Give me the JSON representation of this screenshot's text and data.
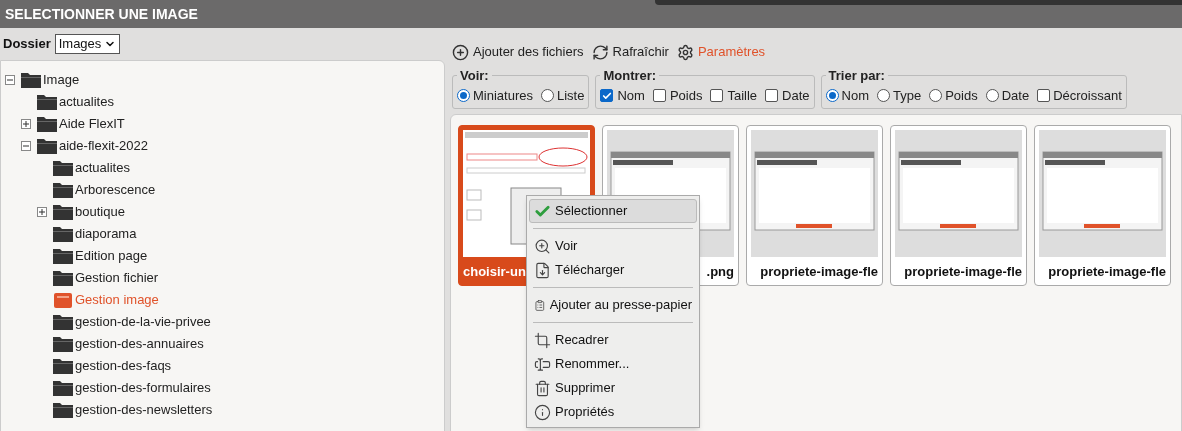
{
  "window": {
    "title": "SELECTIONNER UNE IMAGE"
  },
  "folder_select": {
    "label": "Dossier",
    "value": "Images"
  },
  "tree": [
    {
      "label": "Image",
      "expanded": true,
      "selected": false,
      "children": [
        {
          "label": "actualites",
          "selected": false
        },
        {
          "label": "Aide FlexIT",
          "expanded": false,
          "selected": false
        },
        {
          "label": "aide-flexit-2022",
          "expanded": true,
          "selected": false,
          "children": [
            {
              "label": "actualites",
              "selected": false
            },
            {
              "label": "Arborescence",
              "selected": false
            },
            {
              "label": "boutique",
              "expanded": false,
              "selected": false
            },
            {
              "label": "diaporama",
              "selected": false
            },
            {
              "label": "Edition page",
              "selected": false
            },
            {
              "label": "Gestion fichier",
              "selected": false
            },
            {
              "label": "Gestion image",
              "selected": true
            },
            {
              "label": "gestion-de-la-vie-privee",
              "selected": false
            },
            {
              "label": "gestion-des-annuaires",
              "selected": false
            },
            {
              "label": "gestion-des-faqs",
              "selected": false
            },
            {
              "label": "gestion-des-formulaires",
              "selected": false
            },
            {
              "label": "gestion-des-newsletters",
              "selected": false
            }
          ]
        }
      ]
    }
  ],
  "toolbar": [
    {
      "label": "Ajouter des fichiers",
      "kind": "add",
      "highlighted": false
    },
    {
      "label": "Rafraîchir",
      "kind": "refresh",
      "highlighted": false
    },
    {
      "label": "Paramètres",
      "kind": "settings",
      "highlighted": true
    }
  ],
  "view": {
    "legend": "Voir:",
    "options": [
      {
        "label": "Miniatures",
        "selected": true
      },
      {
        "label": "Liste",
        "selected": false
      }
    ]
  },
  "show": {
    "legend": "Montrer:",
    "options": [
      {
        "label": "Nom",
        "checked": true
      },
      {
        "label": "Poids",
        "checked": false
      },
      {
        "label": "Taille",
        "checked": false
      },
      {
        "label": "Date",
        "checked": false
      }
    ]
  },
  "sort": {
    "legend": "Trier par:",
    "options": [
      {
        "kind": "radio",
        "label": "Nom",
        "selected": true
      },
      {
        "kind": "radio",
        "label": "Type",
        "selected": false
      },
      {
        "kind": "radio",
        "label": "Poids",
        "selected": false
      },
      {
        "kind": "radio",
        "label": "Date",
        "selected": false
      },
      {
        "kind": "checkbox",
        "label": "Décroissant",
        "checked": false
      }
    ]
  },
  "thumbnails": [
    {
      "caption": "choisir-un",
      "selected": true
    },
    {
      "caption": ".png",
      "selected": false
    },
    {
      "caption": "propriete-image-fle",
      "selected": false
    },
    {
      "caption": "propriete-image-fle",
      "selected": false
    },
    {
      "caption": "propriete-image-fle",
      "selected": false
    }
  ],
  "context_menu": [
    {
      "label": "Sélectionner",
      "kind": "select",
      "selected": true,
      "separator_after": true
    },
    {
      "label": "Voir",
      "kind": "view",
      "selected": false,
      "separator_after": false
    },
    {
      "label": "Télécharger",
      "kind": "download",
      "selected": false,
      "separator_after": true
    },
    {
      "label": "Ajouter au presse-papier",
      "kind": "clipboard",
      "selected": false,
      "separator_after": true
    },
    {
      "label": "Recadrer",
      "kind": "crop",
      "selected": false,
      "separator_after": false
    },
    {
      "label": "Renommer...",
      "kind": "rename",
      "selected": false,
      "separator_after": false
    },
    {
      "label": "Supprimer",
      "kind": "delete",
      "selected": false,
      "separator_after": false
    },
    {
      "label": "Propriétés",
      "kind": "properties",
      "selected": false,
      "separator_after": false
    }
  ]
}
